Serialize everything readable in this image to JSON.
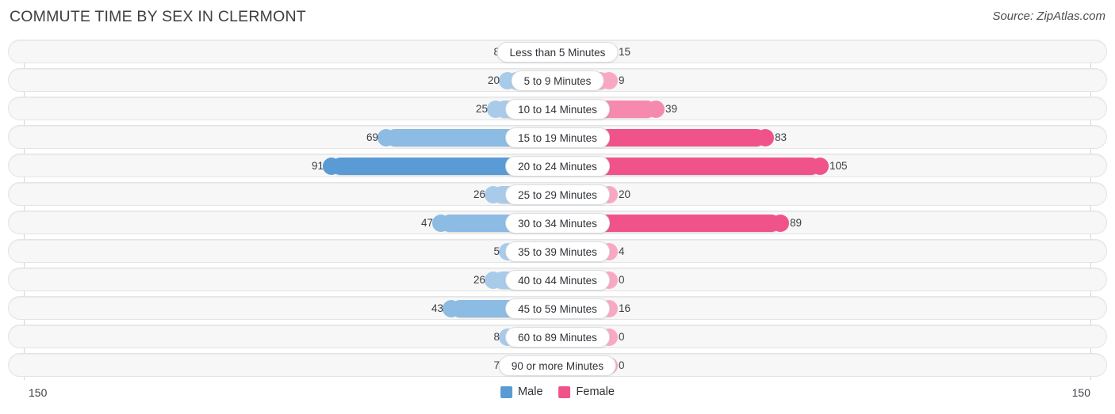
{
  "header": {
    "title": "COMMUTE TIME BY SEX IN CLERMONT",
    "source": "Source: ZipAtlas.com"
  },
  "footer": {
    "axis_max_left": "150",
    "axis_max_right": "150",
    "legend": [
      {
        "label": "Male",
        "color": "#5b9bd5"
      },
      {
        "label": "Female",
        "color": "#f0538a"
      }
    ]
  },
  "colors": {
    "male_light": "#a8cbea",
    "male_mid": "#8cbbe4",
    "male_dark": "#5b9bd5",
    "female_light": "#f9a8c4",
    "female_mid": "#f589ae",
    "female_dark": "#f0538a",
    "track_bg": "#f7f7f7",
    "track_border": "#e3e4e6",
    "axis_line": "#d2d4d7",
    "text": "#3c3f44"
  },
  "chart_data": {
    "type": "bar",
    "subtype": "diverging-butterfly",
    "title": "COMMUTE TIME BY SEX IN CLERMONT",
    "xlabel": "",
    "ylabel": "",
    "axis_max": 150,
    "xlim": [
      150,
      150
    ],
    "grid": false,
    "legend_position": "bottom-center",
    "categories": [
      "Less than 5 Minutes",
      "5 to 9 Minutes",
      "10 to 14 Minutes",
      "15 to 19 Minutes",
      "20 to 24 Minutes",
      "25 to 29 Minutes",
      "30 to 34 Minutes",
      "35 to 39 Minutes",
      "40 to 44 Minutes",
      "45 to 59 Minutes",
      "60 to 89 Minutes",
      "90 or more Minutes"
    ],
    "series": [
      {
        "name": "Male",
        "side": "left",
        "color": "#5b9bd5",
        "values": [
          8,
          20,
          25,
          69,
          91,
          26,
          47,
          5,
          26,
          43,
          8,
          7
        ]
      },
      {
        "name": "Female",
        "side": "right",
        "color": "#f0538a",
        "values": [
          15,
          9,
          39,
          83,
          105,
          20,
          89,
          4,
          0,
          16,
          0,
          0
        ]
      }
    ]
  }
}
